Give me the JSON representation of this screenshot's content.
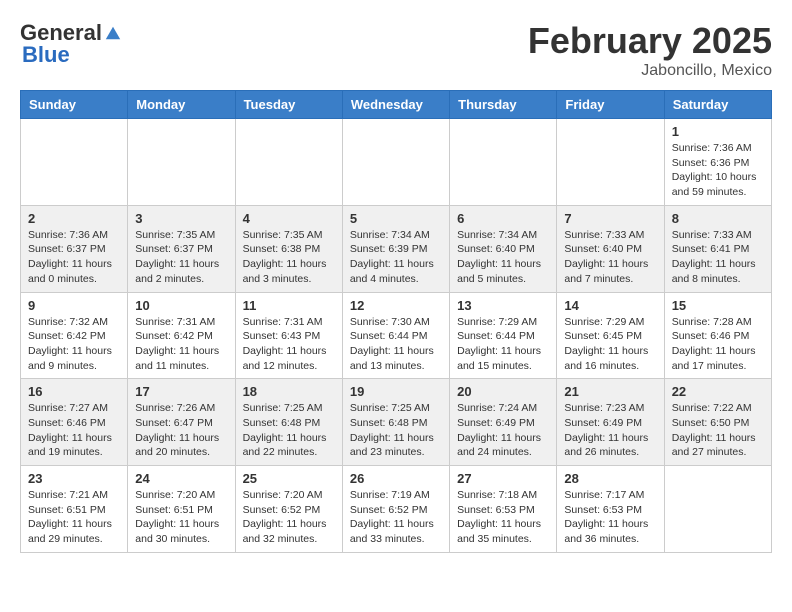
{
  "header": {
    "logo_general": "General",
    "logo_blue": "Blue",
    "month": "February 2025",
    "location": "Jaboncillo, Mexico"
  },
  "weekdays": [
    "Sunday",
    "Monday",
    "Tuesday",
    "Wednesday",
    "Thursday",
    "Friday",
    "Saturday"
  ],
  "weeks": [
    [
      {
        "day": "",
        "info": ""
      },
      {
        "day": "",
        "info": ""
      },
      {
        "day": "",
        "info": ""
      },
      {
        "day": "",
        "info": ""
      },
      {
        "day": "",
        "info": ""
      },
      {
        "day": "",
        "info": ""
      },
      {
        "day": "1",
        "info": "Sunrise: 7:36 AM\nSunset: 6:36 PM\nDaylight: 10 hours\nand 59 minutes."
      }
    ],
    [
      {
        "day": "2",
        "info": "Sunrise: 7:36 AM\nSunset: 6:37 PM\nDaylight: 11 hours\nand 0 minutes."
      },
      {
        "day": "3",
        "info": "Sunrise: 7:35 AM\nSunset: 6:37 PM\nDaylight: 11 hours\nand 2 minutes."
      },
      {
        "day": "4",
        "info": "Sunrise: 7:35 AM\nSunset: 6:38 PM\nDaylight: 11 hours\nand 3 minutes."
      },
      {
        "day": "5",
        "info": "Sunrise: 7:34 AM\nSunset: 6:39 PM\nDaylight: 11 hours\nand 4 minutes."
      },
      {
        "day": "6",
        "info": "Sunrise: 7:34 AM\nSunset: 6:40 PM\nDaylight: 11 hours\nand 5 minutes."
      },
      {
        "day": "7",
        "info": "Sunrise: 7:33 AM\nSunset: 6:40 PM\nDaylight: 11 hours\nand 7 minutes."
      },
      {
        "day": "8",
        "info": "Sunrise: 7:33 AM\nSunset: 6:41 PM\nDaylight: 11 hours\nand 8 minutes."
      }
    ],
    [
      {
        "day": "9",
        "info": "Sunrise: 7:32 AM\nSunset: 6:42 PM\nDaylight: 11 hours\nand 9 minutes."
      },
      {
        "day": "10",
        "info": "Sunrise: 7:31 AM\nSunset: 6:42 PM\nDaylight: 11 hours\nand 11 minutes."
      },
      {
        "day": "11",
        "info": "Sunrise: 7:31 AM\nSunset: 6:43 PM\nDaylight: 11 hours\nand 12 minutes."
      },
      {
        "day": "12",
        "info": "Sunrise: 7:30 AM\nSunset: 6:44 PM\nDaylight: 11 hours\nand 13 minutes."
      },
      {
        "day": "13",
        "info": "Sunrise: 7:29 AM\nSunset: 6:44 PM\nDaylight: 11 hours\nand 15 minutes."
      },
      {
        "day": "14",
        "info": "Sunrise: 7:29 AM\nSunset: 6:45 PM\nDaylight: 11 hours\nand 16 minutes."
      },
      {
        "day": "15",
        "info": "Sunrise: 7:28 AM\nSunset: 6:46 PM\nDaylight: 11 hours\nand 17 minutes."
      }
    ],
    [
      {
        "day": "16",
        "info": "Sunrise: 7:27 AM\nSunset: 6:46 PM\nDaylight: 11 hours\nand 19 minutes."
      },
      {
        "day": "17",
        "info": "Sunrise: 7:26 AM\nSunset: 6:47 PM\nDaylight: 11 hours\nand 20 minutes."
      },
      {
        "day": "18",
        "info": "Sunrise: 7:25 AM\nSunset: 6:48 PM\nDaylight: 11 hours\nand 22 minutes."
      },
      {
        "day": "19",
        "info": "Sunrise: 7:25 AM\nSunset: 6:48 PM\nDaylight: 11 hours\nand 23 minutes."
      },
      {
        "day": "20",
        "info": "Sunrise: 7:24 AM\nSunset: 6:49 PM\nDaylight: 11 hours\nand 24 minutes."
      },
      {
        "day": "21",
        "info": "Sunrise: 7:23 AM\nSunset: 6:49 PM\nDaylight: 11 hours\nand 26 minutes."
      },
      {
        "day": "22",
        "info": "Sunrise: 7:22 AM\nSunset: 6:50 PM\nDaylight: 11 hours\nand 27 minutes."
      }
    ],
    [
      {
        "day": "23",
        "info": "Sunrise: 7:21 AM\nSunset: 6:51 PM\nDaylight: 11 hours\nand 29 minutes."
      },
      {
        "day": "24",
        "info": "Sunrise: 7:20 AM\nSunset: 6:51 PM\nDaylight: 11 hours\nand 30 minutes."
      },
      {
        "day": "25",
        "info": "Sunrise: 7:20 AM\nSunset: 6:52 PM\nDaylight: 11 hours\nand 32 minutes."
      },
      {
        "day": "26",
        "info": "Sunrise: 7:19 AM\nSunset: 6:52 PM\nDaylight: 11 hours\nand 33 minutes."
      },
      {
        "day": "27",
        "info": "Sunrise: 7:18 AM\nSunset: 6:53 PM\nDaylight: 11 hours\nand 35 minutes."
      },
      {
        "day": "28",
        "info": "Sunrise: 7:17 AM\nSunset: 6:53 PM\nDaylight: 11 hours\nand 36 minutes."
      },
      {
        "day": "",
        "info": ""
      }
    ]
  ]
}
